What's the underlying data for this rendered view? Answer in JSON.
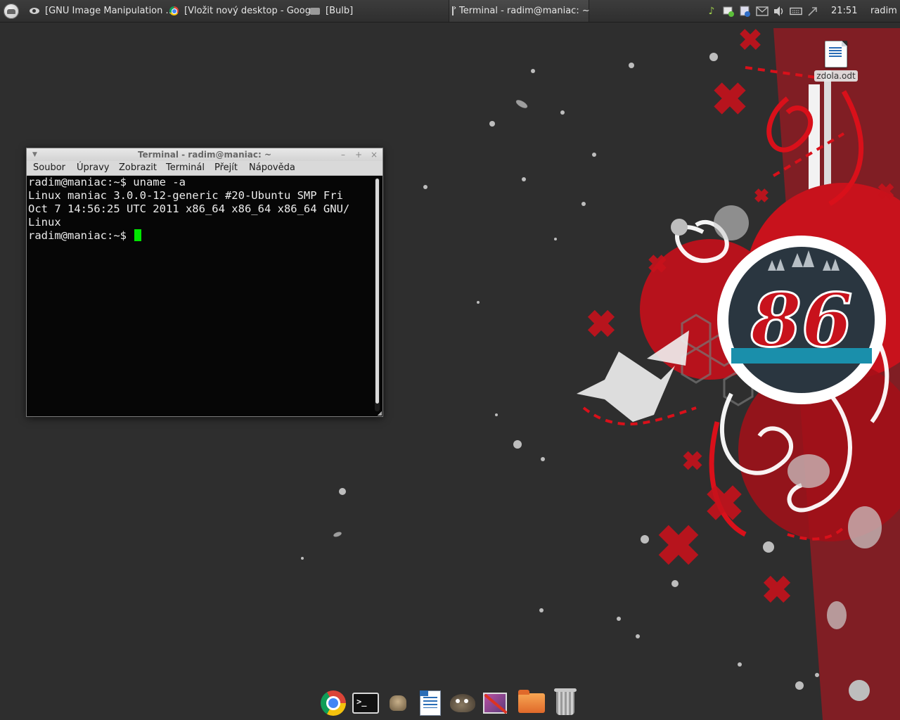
{
  "top_panel": {
    "tasks": [
      {
        "label": "[GNU Image Manipulation ...",
        "icon": "gimp-eye-icon"
      },
      {
        "label": "[Vložit nový desktop - Goog...",
        "icon": "chrome-icon"
      },
      {
        "label": "[Bulb]",
        "icon": "bulb-window-icon"
      },
      {
        "label": "Terminal - radim@maniac: ~",
        "icon": "terminal-icon",
        "active": true
      }
    ],
    "tray_icons": [
      "music-note-icon",
      "network-icon",
      "update-manager-icon",
      "mail-icon",
      "volume-icon",
      "keyboard-icon",
      "bluetooth-icon"
    ],
    "clock": "21:51",
    "user": "radim"
  },
  "desktop": {
    "icons": [
      {
        "label": "zdola.odt",
        "icon": "odt-document-icon"
      }
    ],
    "wallpaper": {
      "accent": "#c8121c",
      "badge_text": "86",
      "teal": "#1a8fab"
    }
  },
  "terminal": {
    "title": "Terminal - radim@maniac: ~",
    "menu": [
      "Soubor",
      "Úpravy",
      "Zobrazit",
      "Terminál",
      "Přejít",
      "Nápověda"
    ],
    "lines": [
      "radim@maniac:~$ uname -a",
      "Linux maniac 3.0.0-12-generic #20-Ubuntu SMP Fri",
      "Oct 7 14:56:25 UTC 2011 x86_64 x86_64 x86_64 GNU/",
      "Linux"
    ],
    "prompt": "radim@maniac:~$ ",
    "cursor_color": "#00e600"
  },
  "dock": {
    "items": [
      "chrome-icon",
      "terminal-icon",
      "bug-icon",
      "writer-icon",
      "gimp-icon",
      "settings-icon",
      "folder-icon",
      "trash-icon"
    ]
  }
}
